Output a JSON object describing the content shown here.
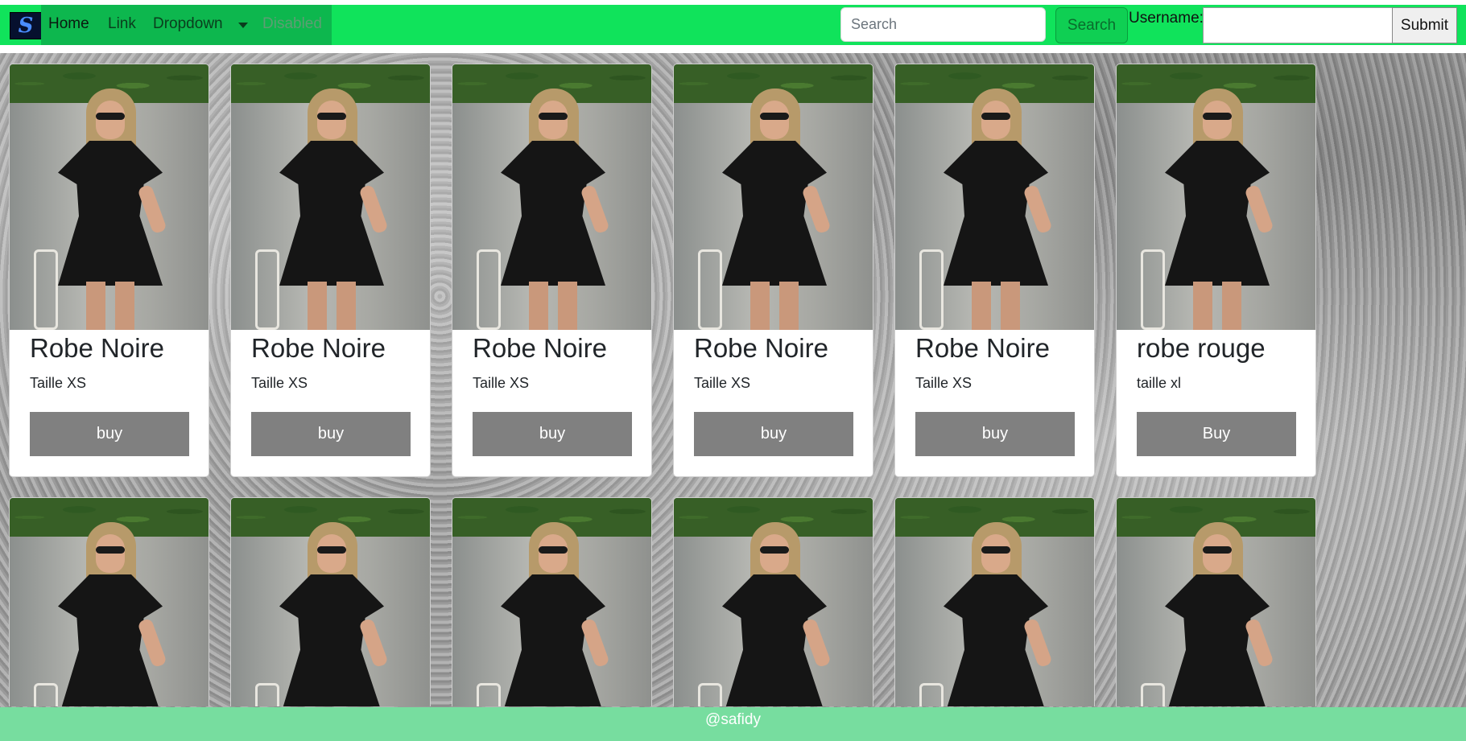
{
  "navbar": {
    "brand_letter": "S",
    "links": {
      "home": "Home",
      "link": "Link",
      "dropdown": "Dropdown",
      "disabled": "Disabled"
    },
    "search": {
      "placeholder": "Search",
      "button": "Search"
    },
    "login": {
      "username_label": "Username:",
      "submit": "Submit"
    },
    "colors": {
      "bar": "#10e35b",
      "nav_group": "#0db74e"
    }
  },
  "products": [
    {
      "title": "Robe Noire",
      "size": "Taille XS",
      "button": "buy"
    },
    {
      "title": "Robe Noire",
      "size": "Taille XS",
      "button": "buy"
    },
    {
      "title": "Robe Noire",
      "size": "Taille XS",
      "button": "buy"
    },
    {
      "title": "Robe Noire",
      "size": "Taille XS",
      "button": "buy"
    },
    {
      "title": "Robe Noire",
      "size": "Taille XS",
      "button": "buy"
    },
    {
      "title": "robe rouge",
      "size": "taille xl",
      "button": "Buy"
    }
  ],
  "product_image_icon": "black-dress-photo",
  "footer": {
    "text": "@safidy",
    "color": "#77dd9f"
  }
}
